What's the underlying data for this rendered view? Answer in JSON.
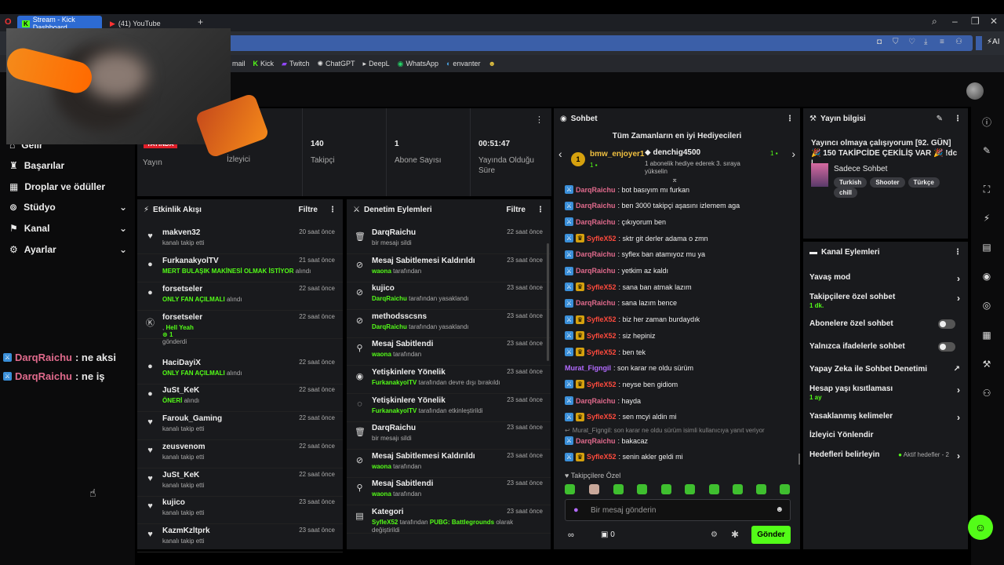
{
  "browser": {
    "tabs": [
      {
        "label": "Stream - Kick Dashboard",
        "active": true
      },
      {
        "label": "(41) YouTube",
        "active": false
      }
    ],
    "bookmarks": [
      "mail",
      "Kick",
      "Twitch",
      "ChatGPT",
      "DeepL",
      "WhatsApp",
      "envanter"
    ],
    "ai_label": "AI"
  },
  "sidebar": {
    "items": [
      {
        "label": "Gelir",
        "icon": "home-icon"
      },
      {
        "label": "Başarılar",
        "icon": "trophy-icon"
      },
      {
        "label": "Droplar ve ödüller",
        "icon": "gift-icon"
      },
      {
        "label": "Stüdyo",
        "icon": "studio-icon",
        "chevron": true
      },
      {
        "label": "Kanal",
        "icon": "channel-icon",
        "chevron": true
      },
      {
        "label": "Ayarlar",
        "icon": "gear-icon",
        "chevron": true
      }
    ]
  },
  "overlay_chat": [
    {
      "user": "DarqRaichu",
      "msg": ": ne aksi"
    },
    {
      "user": "DarqRaichu",
      "msg": ": ne iş"
    }
  ],
  "stats": {
    "live_badge": "YAYINDA",
    "live_label": "Yayın",
    "viewers_label": "İzleyici",
    "followers_value": "140",
    "followers_label": "Takipçi",
    "subs_value": "1",
    "subs_label": "Abone Sayısı",
    "duration_value": "00:51:47",
    "duration_label": "Yayında Olduğu Süre"
  },
  "activity": {
    "title": "Etkinlik Akışı",
    "filter": "Filtre",
    "rows": [
      {
        "name": "makven32",
        "sub": "kanalı takip etti",
        "time": "20 saat önce"
      },
      {
        "name": "FurkanakyolTV",
        "highlight": "MERT BULAŞIK MAKİNESİ OLMAK İSTİYOR",
        "sub": "alındı",
        "time": "21 saat önce"
      },
      {
        "name": "forsetseler",
        "highlight": "ONLY FAN AÇILMALI",
        "sub": "alındı",
        "time": "22 saat önce"
      },
      {
        "name": "forsetseler",
        "highlight": "Hell Yeah",
        "sub": "gönderdi",
        "count": "1",
        "time": "22 saat önce"
      },
      {
        "name": "HaciDayiX",
        "highlight": "ONLY FAN AÇILMALI",
        "sub": "alındı",
        "time": "22 saat önce"
      },
      {
        "name": "JuSt_KeK",
        "highlight": "ÖNERİ",
        "sub": "alındı",
        "time": "22 saat önce"
      },
      {
        "name": "Farouk_Gaming",
        "sub": "kanalı takip etti",
        "time": "22 saat önce"
      },
      {
        "name": "zeusvenom",
        "sub": "kanalı takip etti",
        "time": "22 saat önce"
      },
      {
        "name": "JuSt_KeK",
        "sub": "kanalı takip etti",
        "time": "22 saat önce"
      },
      {
        "name": "kujico",
        "sub": "kanalı takip etti",
        "time": "23 saat önce"
      },
      {
        "name": "KazmKzltprk",
        "sub": "kanalı takip etti",
        "time": "23 saat önce"
      }
    ]
  },
  "moderation": {
    "title": "Denetim Eylemleri",
    "filter": "Filtre",
    "rows": [
      {
        "name": "DarqRaichu",
        "sub": "bir mesajı sildi",
        "time": "22 saat önce",
        "icon": "trash-icon"
      },
      {
        "name": "Mesaj Sabitlemesi Kaldırıldı",
        "highlight": "waona",
        "sub": "tarafından",
        "time": "23 saat önce",
        "icon": "unpin-icon"
      },
      {
        "name": "kujico",
        "highlight": "DarqRaichu",
        "sub": "tarafından yasaklandı",
        "time": "23 saat önce",
        "icon": "ban-icon"
      },
      {
        "name": "methodsscsns",
        "highlight": "DarqRaichu",
        "sub": "tarafından yasaklandı",
        "time": "23 saat önce",
        "icon": "ban-icon"
      },
      {
        "name": "Mesaj Sabitlendi",
        "highlight": "waona",
        "sub": "tarafından",
        "time": "23 saat önce",
        "icon": "pin-icon"
      },
      {
        "name": "Yetişkinlere Yönelik",
        "highlight": "FurkanakyolTV",
        "sub": "tarafından devre dışı bırakıldı",
        "time": "23 saat önce",
        "icon": "eye-icon"
      },
      {
        "name": "Yetişkinlere Yönelik",
        "highlight": "FurkanakyolTV",
        "sub": "tarafından etkinleştirildi",
        "time": "23 saat önce",
        "icon": "eye-off-icon"
      },
      {
        "name": "DarqRaichu",
        "sub": "bir mesajı sildi",
        "time": "23 saat önce",
        "icon": "trash-icon"
      },
      {
        "name": "Mesaj Sabitlemesi Kaldırıldı",
        "highlight": "waona",
        "sub": "tarafından",
        "time": "23 saat önce",
        "icon": "unpin-icon"
      },
      {
        "name": "Mesaj Sabitlendi",
        "highlight": "waona",
        "sub": "tarafından",
        "time": "23 saat önce",
        "icon": "pin-icon"
      },
      {
        "name": "Kategori",
        "highlight": "SyfleX52",
        "sub": "tarafından",
        "highlight2": "PUBG: Battlegrounds",
        "sub2": "olarak değiştirildi",
        "time": "23 saat önce",
        "icon": "category-icon"
      }
    ]
  },
  "chat": {
    "title": "Sohbet",
    "gifters_title": "Tüm Zamanların en iyi Hediyecileri",
    "gifter1_name": "bmw_enjoyer1",
    "gifter1_count": "1",
    "gifter2_name": "denchig4500",
    "gifter2_count": "1",
    "gifter2_note": "1 abonelik hediye ederek 3. sıraya yükselin",
    "messages": [
      {
        "user": "DarqRaichu",
        "color": "p",
        "crown": false,
        "text": ": bot basıyım mı furkan"
      },
      {
        "user": "DarqRaichu",
        "color": "p",
        "crown": false,
        "text": ": ben 3000 takipçi aşasını izlemem aga"
      },
      {
        "user": "DarqRaichu",
        "color": "p",
        "crown": false,
        "text": ": çıkıyorum ben"
      },
      {
        "user": "SyfleX52",
        "color": "r",
        "crown": true,
        "text": ": sktr git derler adama o zmn"
      },
      {
        "user": "DarqRaichu",
        "color": "p",
        "crown": false,
        "text": ": syflex ban atamıyoz mu ya"
      },
      {
        "user": "DarqRaichu",
        "color": "p",
        "crown": false,
        "text": ": yetkim az kaldı"
      },
      {
        "user": "SyfleX52",
        "color": "r",
        "crown": true,
        "text": ": sana ban atmak lazım"
      },
      {
        "user": "DarqRaichu",
        "color": "p",
        "crown": false,
        "text": ": sana lazım bence"
      },
      {
        "user": "SyfleX52",
        "color": "r",
        "crown": true,
        "text": ": biz her zaman burdaydık"
      },
      {
        "user": "SyfleX52",
        "color": "r",
        "crown": true,
        "text": ": siz hepiniz"
      },
      {
        "user": "SyfleX52",
        "color": "r",
        "crown": true,
        "text": ": ben tek"
      },
      {
        "user": "Murat_Figngil",
        "color": "v",
        "crown": false,
        "text": ": son karar ne oldu sürüm"
      },
      {
        "user": "SyfleX52",
        "color": "r",
        "crown": true,
        "text": ": neyse ben gidiom"
      },
      {
        "user": "DarqRaichu",
        "color": "p",
        "crown": false,
        "text": ": hayda"
      },
      {
        "user": "SyfleX52",
        "color": "r",
        "crown": true,
        "text": ": sen mcyi aldin mi"
      }
    ],
    "reply_note": "Murat_Figngil: son karar ne oldu sürüm isimli kullanıcıya yanıt veriyor",
    "after_reply": [
      {
        "user": "DarqRaichu",
        "color": "p",
        "crown": false,
        "text": ": bakacaz"
      },
      {
        "user": "SyfleX52",
        "color": "r",
        "crown": true,
        "text": ": senin akler geldi mi"
      }
    ],
    "followers_only_label": "Takipçilere Özel",
    "input_placeholder": "Bir mesaj gönderin",
    "points": "0",
    "send_label": "Gönder"
  },
  "stream_info": {
    "title": "Yayın bilgisi",
    "stream_title": "Yayıncı olmaya çalışıyorum [92. GÜN] 🎉 150 TAKİPCİDE ÇEKİLİŞ VAR 🎉 !dc |...",
    "category": "Sadece Sohbet",
    "tags": [
      "Turkish",
      "Shooter",
      "Türkçe",
      "chill"
    ]
  },
  "channel_actions": {
    "title": "Kanal Eylemleri",
    "items": [
      {
        "label": "Yavaş mod",
        "control": "arrow"
      },
      {
        "label": "Takipçilere özel sohbet",
        "sub": "1 dk.",
        "control": "arrow"
      },
      {
        "label": "Abonelere özel sohbet",
        "control": "toggle"
      },
      {
        "label": "Yalnızca ifadelerle sohbet",
        "control": "toggle"
      },
      {
        "label": "Yapay Zeka ile Sohbet Denetimi",
        "control": "external"
      },
      {
        "label": "Hesap yaşı kısıtlaması",
        "sub": "1 ay",
        "control": "arrow"
      },
      {
        "label": "Yasaklanmış kelimeler",
        "control": "arrow"
      },
      {
        "label": "İzleyici Yönlendir",
        "control": "none"
      },
      {
        "label": "Hedefleri belirleyin",
        "control": "arrow",
        "note": "Aktif hedefler - 2"
      }
    ]
  },
  "colors": {
    "accent": "#53fc18",
    "panel": "#191a1d",
    "bg": "#0b0b0c",
    "pink_user": "#e06a8c",
    "red_user": "#ff4a3d",
    "purple_user": "#b36bff"
  }
}
